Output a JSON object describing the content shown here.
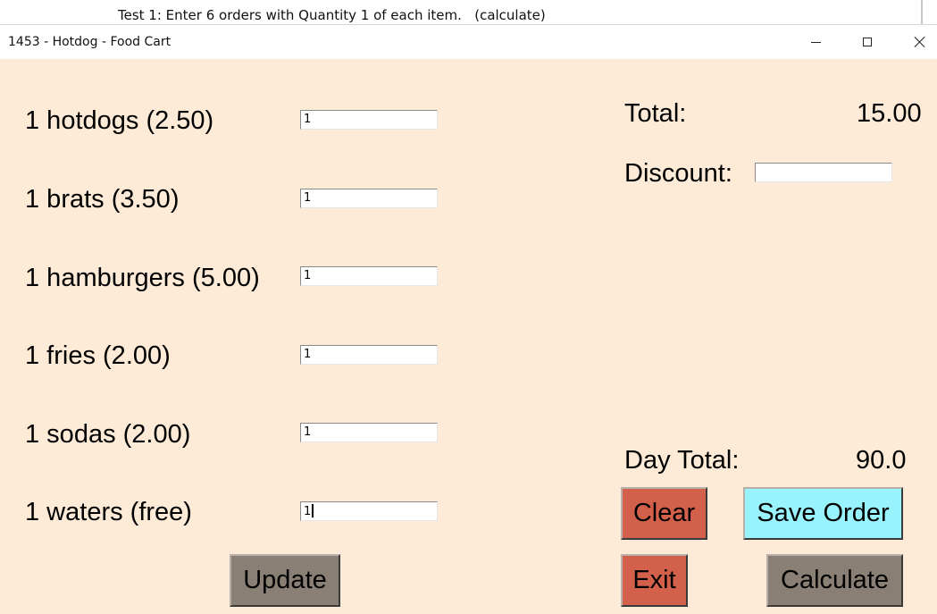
{
  "background_doc": {
    "text": "Test 1: Enter 6 orders with Quantity 1 of each item.   (calculate)"
  },
  "window": {
    "title": "1453 - Hotdog - Food Cart"
  },
  "items": [
    {
      "label": "1 hotdogs (2.50)",
      "qty": "1"
    },
    {
      "label": "1 brats (3.50)",
      "qty": "1"
    },
    {
      "label": "1 hamburgers (5.00)",
      "qty": "1"
    },
    {
      "label": "1 fries (2.00)",
      "qty": "1"
    },
    {
      "label": "1 sodas (2.00)",
      "qty": "1"
    },
    {
      "label": "1 waters (free)",
      "qty": "1"
    }
  ],
  "summary": {
    "total_label": "Total:",
    "total_value": "15.00",
    "discount_label": "Discount:",
    "discount_value": "",
    "day_total_label": "Day Total:",
    "day_total_value": "90.0"
  },
  "buttons": {
    "update": "Update",
    "clear": "Clear",
    "save_order": "Save Order",
    "exit": "Exit",
    "calculate": "Calculate"
  },
  "colors": {
    "window_bg": "#fdebd8",
    "red_button": "#d2604a",
    "cyan_button": "#98f3fd",
    "gray_button": "#8a7f74"
  }
}
